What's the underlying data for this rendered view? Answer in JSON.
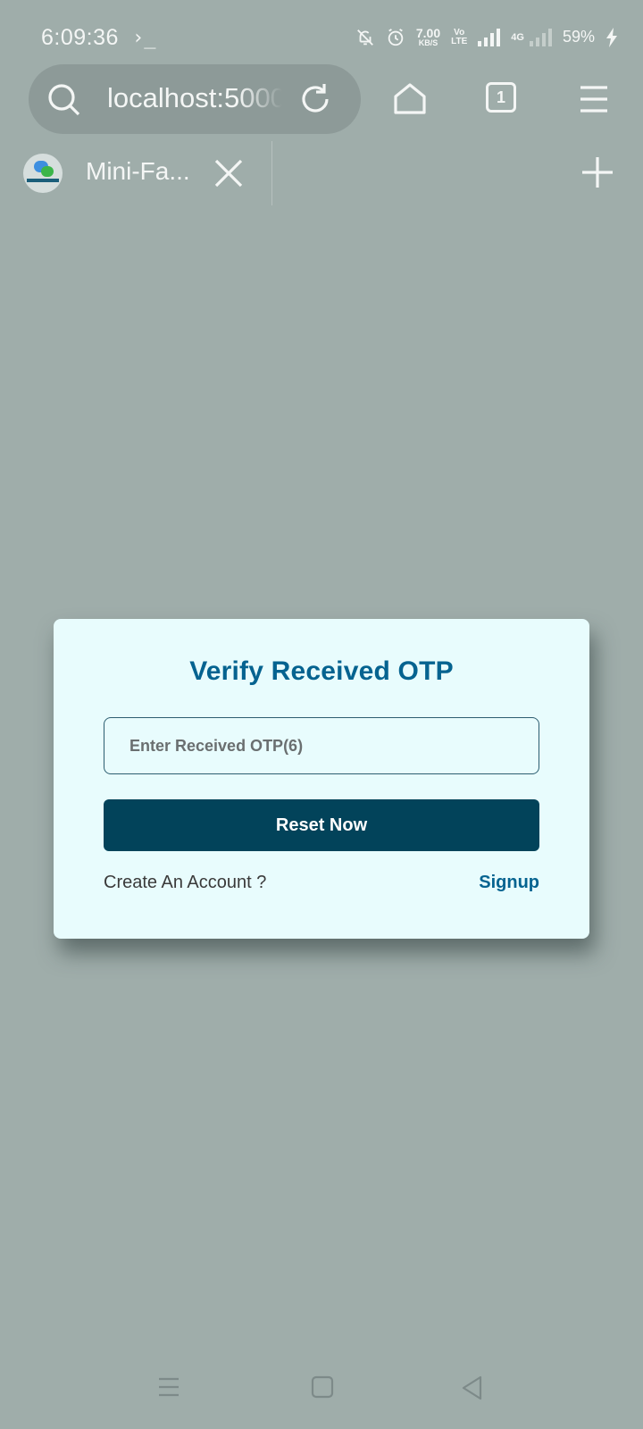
{
  "status_bar": {
    "time": "6:09:36",
    "terminal_glyph": "›_",
    "net_speed_value": "7.00",
    "net_speed_unit": "KB/S",
    "volte_top": "Vo",
    "volte_bottom": "LTE",
    "network_type": "4G",
    "battery": "59%",
    "icons": [
      "notifications-off-icon",
      "alarm-icon",
      "signal-icon",
      "charging-icon"
    ]
  },
  "browser": {
    "url": "localhost:5000",
    "tab_count": "1",
    "tab": {
      "title": "Mini-Fa...",
      "favicon_name": "mini-facebook-favicon"
    }
  },
  "card": {
    "title": "Verify Received OTP",
    "otp_placeholder": "Enter Received OTP(6)",
    "otp_value": "",
    "submit_label": "Reset Now",
    "prompt_text": "Create An Account ?",
    "signup_label": "Signup"
  },
  "colors": {
    "page_background": "#9fadaa",
    "card_background": "#e8fcfd",
    "title_color": "#056390",
    "button_background": "#02435a",
    "link_color": "#056390"
  }
}
